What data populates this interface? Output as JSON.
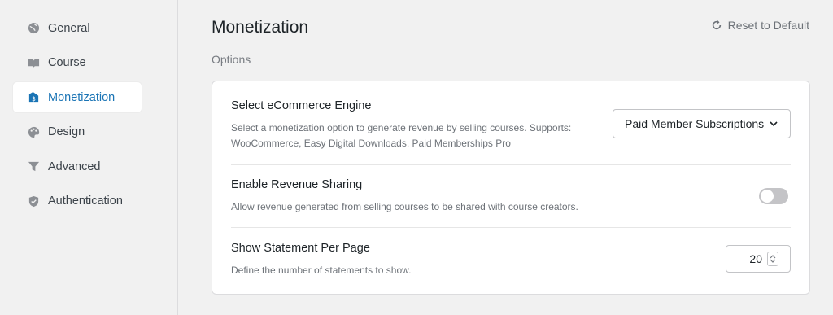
{
  "sidebar": {
    "items": [
      {
        "label": "General",
        "icon": "globe-icon",
        "active": false
      },
      {
        "label": "Course",
        "icon": "book-icon",
        "active": false
      },
      {
        "label": "Monetization",
        "icon": "money-icon",
        "active": true
      },
      {
        "label": "Design",
        "icon": "palette-icon",
        "active": false
      },
      {
        "label": "Advanced",
        "icon": "filter-icon",
        "active": false
      },
      {
        "label": "Authentication",
        "icon": "shield-icon",
        "active": false
      }
    ]
  },
  "header": {
    "title": "Monetization",
    "reset_label": "Reset to Default"
  },
  "section": {
    "label": "Options"
  },
  "settings": {
    "ecommerce": {
      "title": "Select eCommerce Engine",
      "description_line1": "Select a monetization option to generate revenue by selling courses. Supports:",
      "description_line2": "WooCommerce, Easy Digital Downloads, Paid Memberships Pro",
      "selected": "Paid Member Subscriptions"
    },
    "revenue_sharing": {
      "title": "Enable Revenue Sharing",
      "description": "Allow revenue generated from selling courses to be shared with course creators.",
      "enabled": false
    },
    "statements": {
      "title": "Show Statement Per Page",
      "description": "Define the number of statements to show.",
      "value": "20"
    }
  },
  "colors": {
    "accent": "#1a74b5",
    "background": "#f1f1f1",
    "toggle_off": "#c4c4c7"
  }
}
